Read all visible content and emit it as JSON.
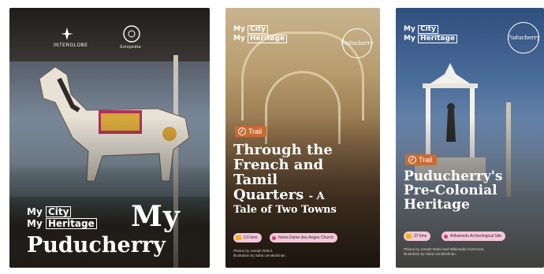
{
  "cards": [
    {
      "logos": [
        "INTERGLOBE",
        "Solopedia"
      ],
      "brand": {
        "line1": "My",
        "line1_box": "City",
        "line2": "My",
        "line2_box": "Heritage"
      },
      "title_line1": "My",
      "title_line2": "Puducherry"
    },
    {
      "brand": {
        "line1": "My",
        "line1_box": "City",
        "line2": "My",
        "line2_box": "Heritage"
      },
      "stamp": "Puducherry",
      "tag": "Trail",
      "title": [
        "Through the",
        "French and",
        "Tamil",
        "Quarters",
        "- A",
        "Tale of Two Towns"
      ],
      "distance": "2.6 kms",
      "start": "Notre-Dame des-Anges Church",
      "credits": [
        "Photos by Joseph Rahul.",
        "Illustration by Saha Unnikrishnan."
      ]
    },
    {
      "brand": {
        "line1": "My",
        "line1_box": "City",
        "line2": "My",
        "line2_box": "Heritage"
      },
      "stamp": "Puducherry",
      "tag": "Trail",
      "title": [
        "Puducherry's",
        "Pre-Colonial",
        "Heritage"
      ],
      "distance": "37 kms",
      "start": "Arikamedu Archeological Site",
      "credits": [
        "Photos by Joseph Rahul and Wikimedia Commons.",
        "Illustration by Saha Unnikrishnan."
      ]
    }
  ],
  "colors": {
    "tag": "#c86b33",
    "pill": "#f3c7d9",
    "pill_icon": "#f0b31d"
  },
  "icons": [
    "interglobe-logo-icon",
    "solopedia-logo-icon",
    "trail-compass-icon",
    "distance-icon",
    "location-pin-icon"
  ]
}
